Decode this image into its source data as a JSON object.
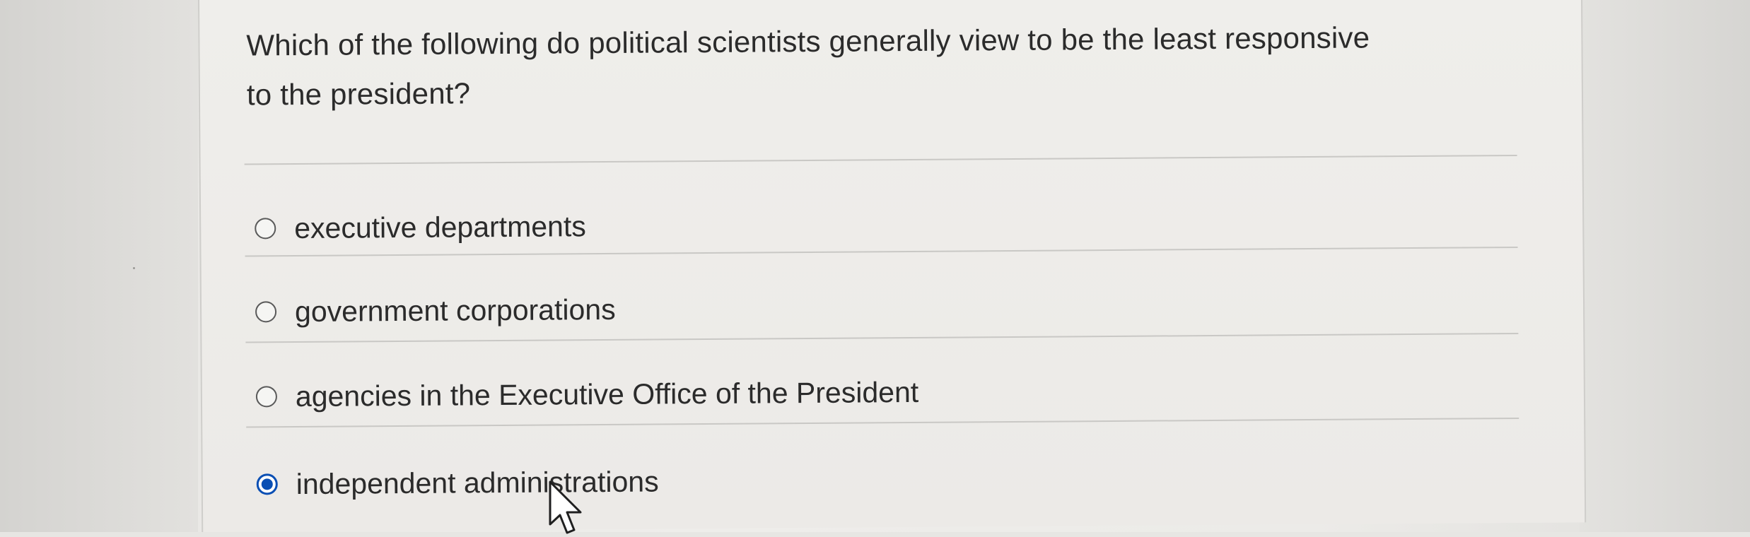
{
  "question": {
    "text_line1": "Which of the following do political scientists generally view to be the least responsive",
    "text_line2": "to the president?"
  },
  "options": [
    {
      "label": "executive departments",
      "selected": false
    },
    {
      "label": "government corporations",
      "selected": false
    },
    {
      "label": "agencies in the Executive Office of the President",
      "selected": false
    },
    {
      "label": "independent administrations",
      "selected": true
    }
  ],
  "colors": {
    "radio_selected": "#0a4fb4",
    "text": "#2b2b2b"
  },
  "icons": {
    "cursor": "mouse-pointer-icon"
  }
}
